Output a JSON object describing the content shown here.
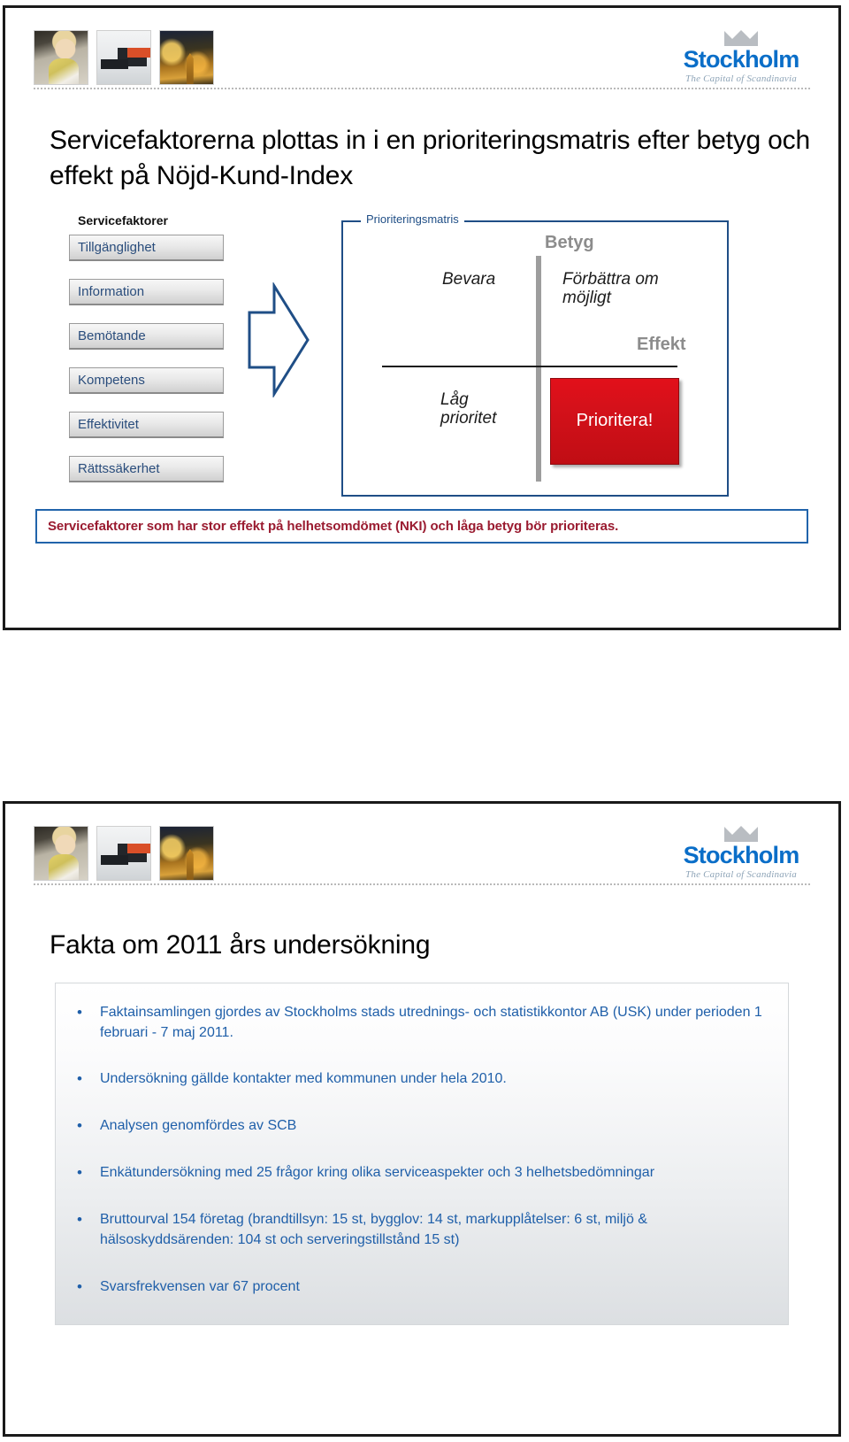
{
  "brand": {
    "logo_word": "Stockholm",
    "logo_tagline": "The Capital of Scandinavia",
    "photo_1_alt": "woman-with-cup-photo",
    "photo_2_alt": "modern-furniture-photo",
    "photo_3_alt": "city-at-night-photo"
  },
  "slide1": {
    "title": "Servicefaktorerna plottas in i en prioriteringsmatris efter betyg och effekt på Nöjd-Kund-Index",
    "factors_heading": "Servicefaktorer",
    "factors": [
      "Tillgänglighet",
      "Information",
      "Bemötande",
      "Kompetens",
      "Effektivitet",
      "Rättssäkerhet"
    ],
    "matrix": {
      "legend": "Prioriteringsmatris",
      "axis_y": "Betyg",
      "axis_x": "Effekt",
      "quadrant_top_left": "Bevara",
      "quadrant_top_right": "Förbättra om möjligt",
      "quadrant_bottom_left": "Låg prioritet",
      "quadrant_bottom_right": "Prioritera!",
      "highlight_color": "#d4111a",
      "border_color": "#1f4e86"
    },
    "caption": "Servicefaktorer som har stor effekt på helhetsomdömet (NKI) och låga betyg bör prioriteras.",
    "caption_color": "#9a1b30"
  },
  "slide2": {
    "title": "Fakta om 2011 års undersökning",
    "bullet_symbol": "•",
    "bullets": [
      "Faktainsamlingen gjordes av Stockholms stads utrednings- och statistikkontor AB (USK) under perioden 1 februari - 7 maj 2011.",
      "Undersökning gällde kontakter med kommunen under hela 2010.",
      "Analysen genomfördes av SCB",
      "Enkätundersökning med 25 frågor kring olika serviceaspekter och 3 helhetsbedömningar",
      "Bruttourval 154 företag (brandtillsyn: 15 st, bygglov: 14 st, markupplåtelser: 6 st, miljö & hälsoskyddsärenden: 104 st och serveringstillstånd 15 st)",
      "Svarsfrekvensen var 67 procent"
    ],
    "text_color": "#1f5fa9"
  }
}
